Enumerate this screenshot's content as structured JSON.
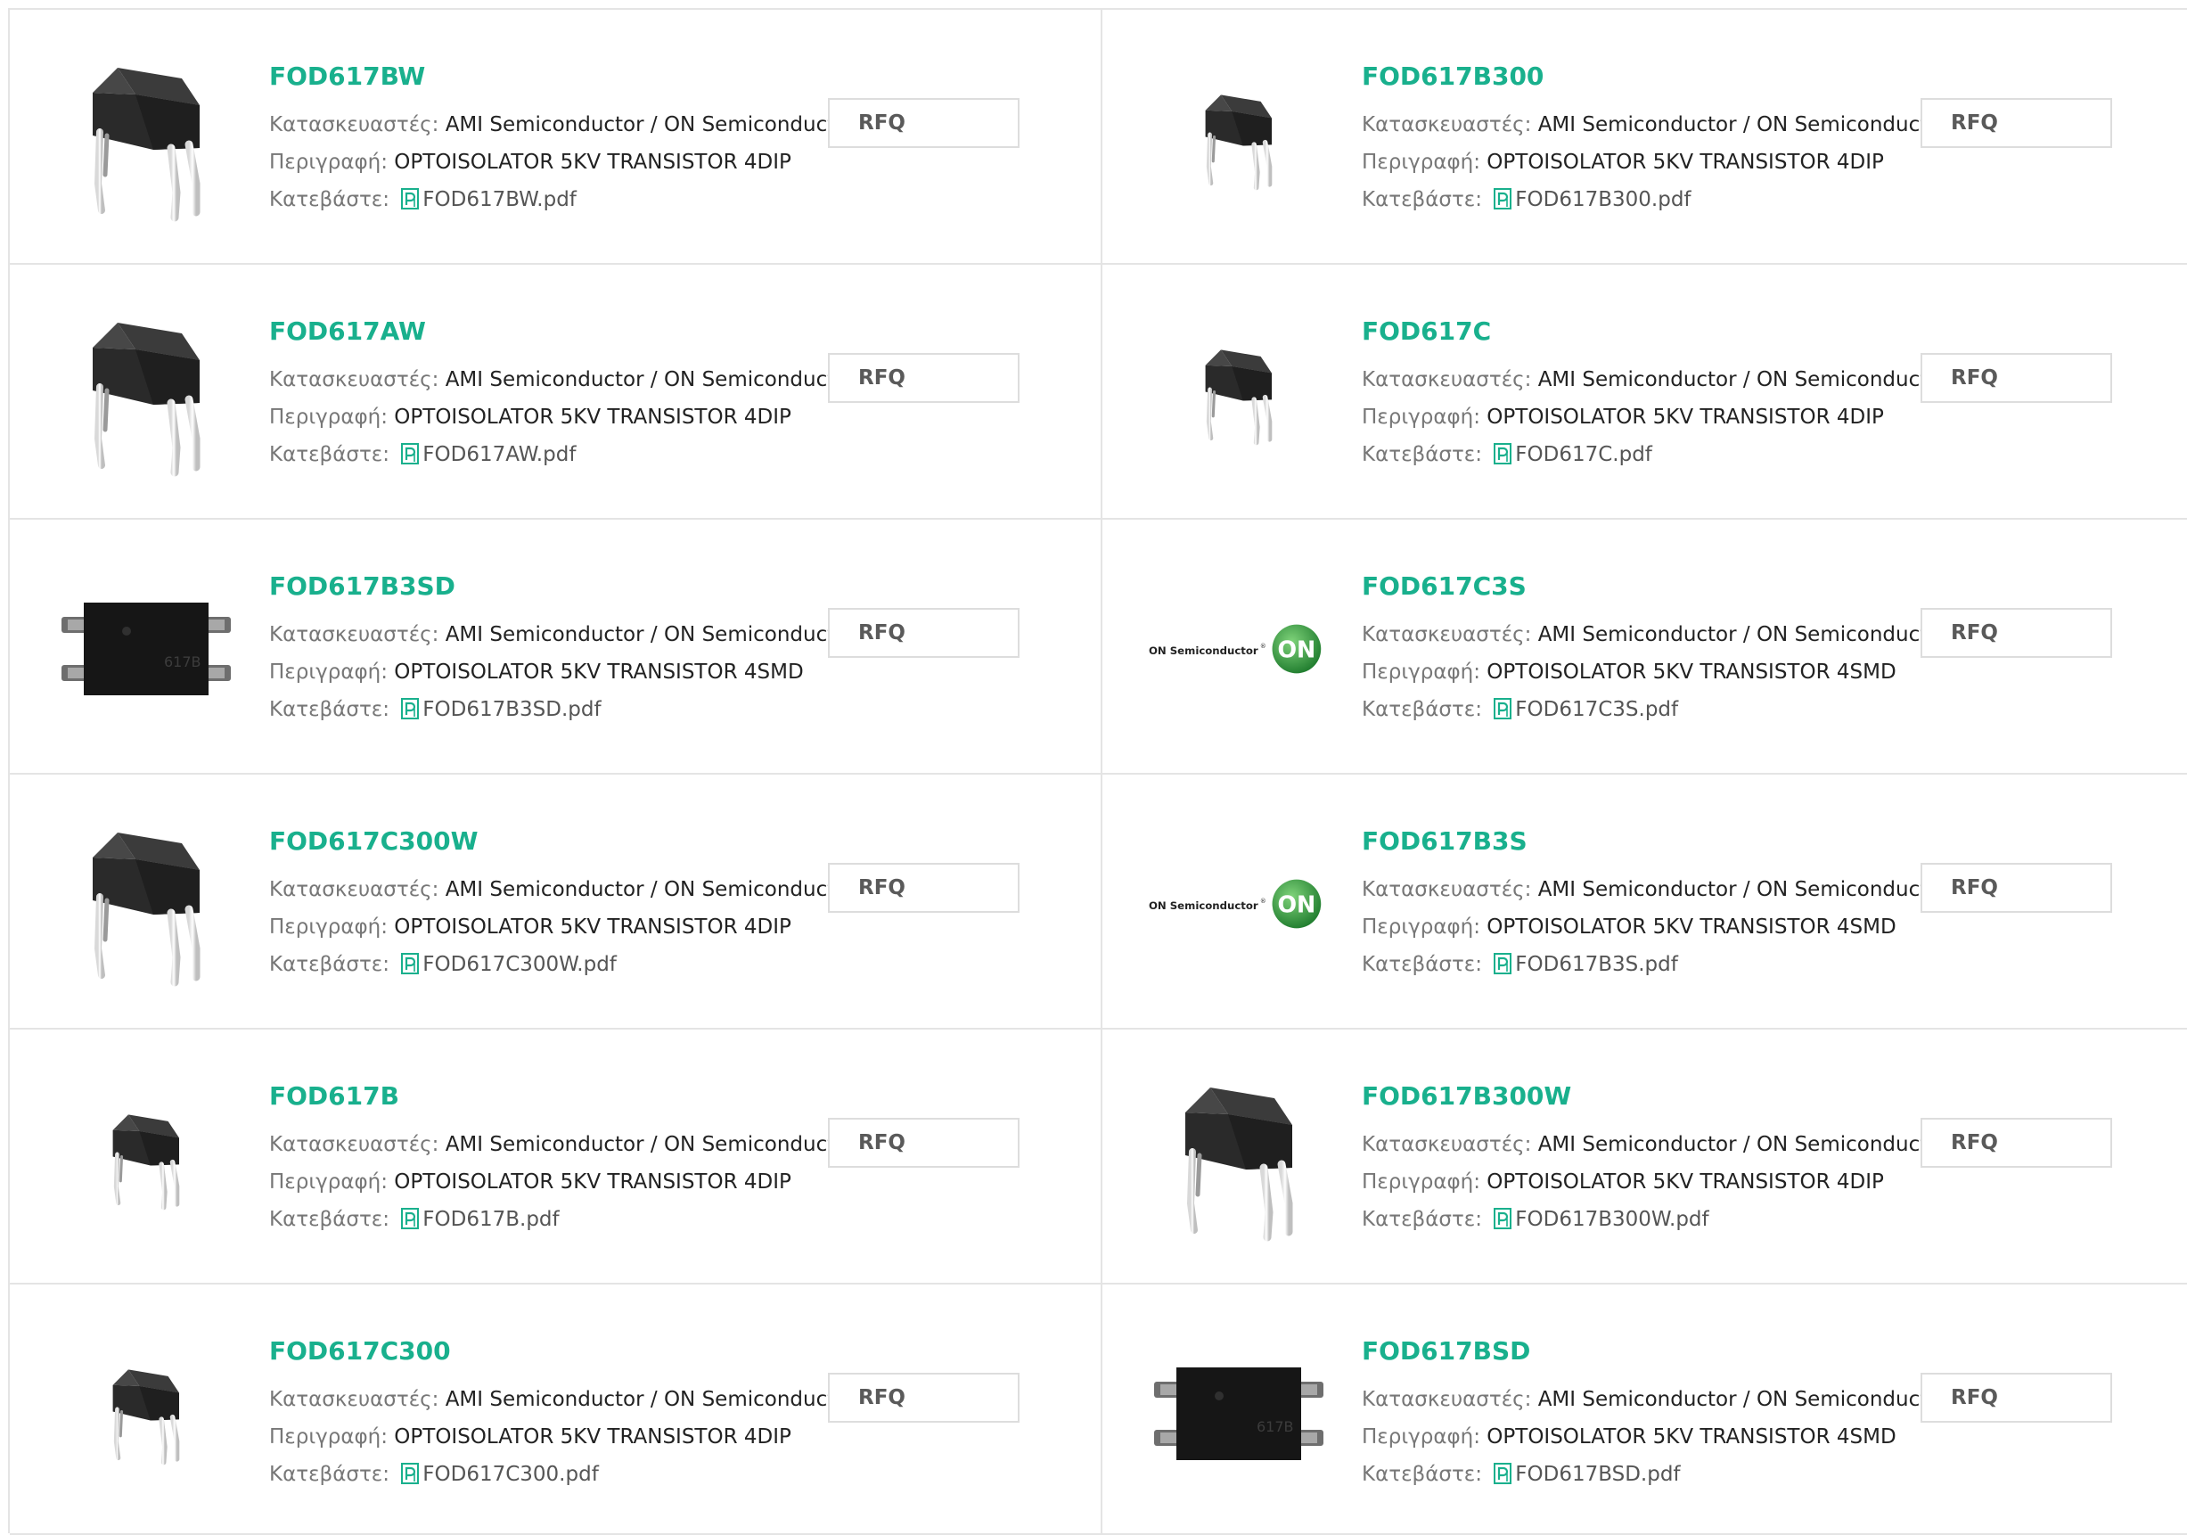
{
  "labels": {
    "manufacturer": "Κατασκευαστές:",
    "description": "Περιγραφή:",
    "download": "Κατεβάστε:",
    "rfq": "RFQ"
  },
  "colors": {
    "title": "#19b08d",
    "border": "#e4e4e4",
    "pdf_icon": "#19b08d",
    "on_logo": "#2e9b3e"
  },
  "products": [
    {
      "name": "FOD617BW",
      "manufacturer": "AMI Semiconductor / ON Semiconductor",
      "description": "OPTOISOLATOR 5KV TRANSISTOR 4DIP",
      "pdf": "FOD617BW.pdf",
      "image": "dip-large"
    },
    {
      "name": "FOD617B300",
      "manufacturer": "AMI Semiconductor / ON Semiconductor",
      "description": "OPTOISOLATOR 5KV TRANSISTOR 4DIP",
      "pdf": "FOD617B300.pdf",
      "image": "dip-small"
    },
    {
      "name": "FOD617AW",
      "manufacturer": "AMI Semiconductor / ON Semiconductor",
      "description": "OPTOISOLATOR 5KV TRANSISTOR 4DIP",
      "pdf": "FOD617AW.pdf",
      "image": "dip-large"
    },
    {
      "name": "FOD617C",
      "manufacturer": "AMI Semiconductor / ON Semiconductor",
      "description": "OPTOISOLATOR 5KV TRANSISTOR 4DIP",
      "pdf": "FOD617C.pdf",
      "image": "dip-small"
    },
    {
      "name": "FOD617B3SD",
      "manufacturer": "AMI Semiconductor / ON Semiconductor",
      "description": "OPTOISOLATOR 5KV TRANSISTOR 4SMD",
      "pdf": "FOD617B3SD.pdf",
      "image": "smd",
      "mark": "617B"
    },
    {
      "name": "FOD617C3S",
      "manufacturer": "AMI Semiconductor / ON Semiconductor",
      "description": "OPTOISOLATOR 5KV TRANSISTOR 4SMD",
      "pdf": "FOD617C3S.pdf",
      "image": "on-logo",
      "logo_text": "ON Semiconductor",
      "logo_mark": "ON"
    },
    {
      "name": "FOD617C300W",
      "manufacturer": "AMI Semiconductor / ON Semiconductor",
      "description": "OPTOISOLATOR 5KV TRANSISTOR 4DIP",
      "pdf": "FOD617C300W.pdf",
      "image": "dip-large"
    },
    {
      "name": "FOD617B3S",
      "manufacturer": "AMI Semiconductor / ON Semiconductor",
      "description": "OPTOISOLATOR 5KV TRANSISTOR 4SMD",
      "pdf": "FOD617B3S.pdf",
      "image": "on-logo",
      "logo_text": "ON Semiconductor",
      "logo_mark": "ON"
    },
    {
      "name": "FOD617B",
      "manufacturer": "AMI Semiconductor / ON Semiconductor",
      "description": "OPTOISOLATOR 5KV TRANSISTOR 4DIP",
      "pdf": "FOD617B.pdf",
      "image": "dip-small"
    },
    {
      "name": "FOD617B300W",
      "manufacturer": "AMI Semiconductor / ON Semiconductor",
      "description": "OPTOISOLATOR 5KV TRANSISTOR 4DIP",
      "pdf": "FOD617B300W.pdf",
      "image": "dip-large"
    },
    {
      "name": "FOD617C300",
      "manufacturer": "AMI Semiconductor / ON Semiconductor",
      "description": "OPTOISOLATOR 5KV TRANSISTOR 4DIP",
      "pdf": "FOD617C300.pdf",
      "image": "dip-small"
    },
    {
      "name": "FOD617BSD",
      "manufacturer": "AMI Semiconductor / ON Semiconductor",
      "description": "OPTOISOLATOR 5KV TRANSISTOR 4SMD",
      "pdf": "FOD617BSD.pdf",
      "image": "smd",
      "mark": "617B"
    }
  ]
}
